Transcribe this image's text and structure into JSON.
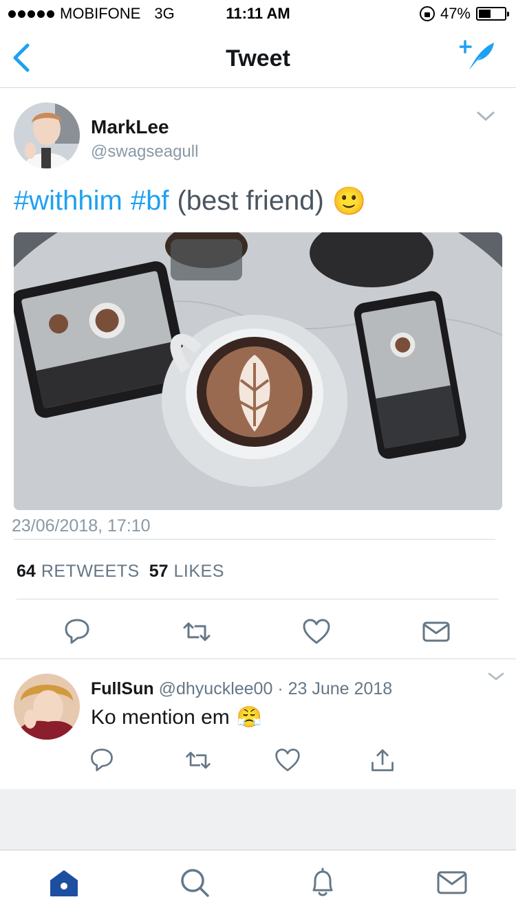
{
  "status_bar": {
    "carrier": "MOBIFONE",
    "network": "3G",
    "time": "11:11 AM",
    "battery": "47%",
    "battery_level": 0.47
  },
  "nav": {
    "title": "Tweet",
    "back_icon": "chevron-left-icon",
    "compose_icon": "compose-tweet-icon"
  },
  "tweet": {
    "author_name": "MarkLee",
    "author_handle": "@swagseagull",
    "hashtag1": "#withhim",
    "hashtag2": "#bf",
    "text_rest": "(best friend)",
    "emoji": "🙂",
    "timestamp": "23/06/2018, 17:10",
    "retweets_count": "64",
    "retweets_label": "RETWEETS",
    "likes_count": "57",
    "likes_label": "LIKES"
  },
  "reply": {
    "name": "FullSun",
    "handle": "@dhyucklee00",
    "separator": "·",
    "date": "23 June 2018",
    "text": "Ko mention em",
    "emoji": "😤"
  },
  "tabs": [
    "home-icon",
    "search-icon",
    "notifications-icon",
    "messages-icon"
  ],
  "colors": {
    "accent": "#1da1f2",
    "muted": "#8899a6",
    "tab_active": "#1d4fa0"
  }
}
